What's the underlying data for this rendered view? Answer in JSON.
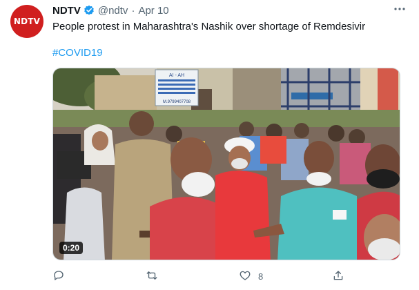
{
  "tweet": {
    "author_name": "NDTV",
    "avatar_text": "NDTV",
    "handle": "@ndtv",
    "separator": "·",
    "date": "Apr 10",
    "text": "People protest in Maharashtra's Nashik over shortage of Remdesivir",
    "hashtag": "#COVID19",
    "video_duration": "0:20",
    "sign_text": "AI - AH",
    "sign_phone": "M.9799407708",
    "like_count": "8"
  },
  "icons": {
    "verified": "verified-badge-icon",
    "more": "more-options-icon",
    "reply": "reply-icon",
    "retweet": "retweet-icon",
    "like": "like-icon",
    "share": "share-icon"
  },
  "colors": {
    "accent": "#1d9bf0",
    "brand": "#d01f1f",
    "secondary_text": "#536471"
  }
}
